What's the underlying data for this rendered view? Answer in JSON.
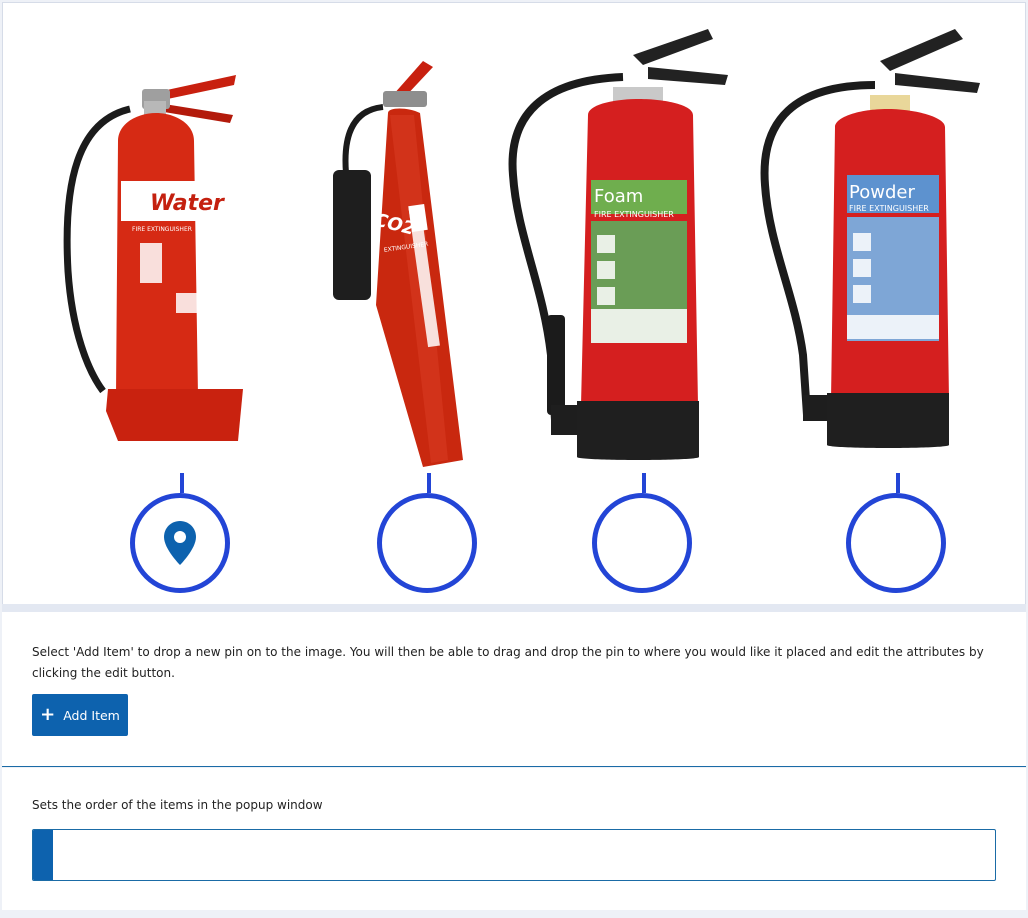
{
  "extinguishers": [
    {
      "label": "Water",
      "subtitle": "FIRE EXTINGUISHER",
      "body_color": "#d62a14",
      "label_color": "#ffffff",
      "text_color": "#c4200f",
      "has_pin": true
    },
    {
      "label": "CO2",
      "subtitle": "EXTINGUISHER",
      "body_color": "#c9280f",
      "label_color": "#ffffff",
      "text_color": "#c4200f",
      "has_pin": false
    },
    {
      "label": "Foam",
      "subtitle": "FIRE EXTINGUISHER",
      "body_color": "#d51f1f",
      "label_color": "#6fae4e",
      "text_color": "#ffffff",
      "has_pin": false
    },
    {
      "label": "Powder",
      "subtitle": "FIRE EXTINGUISHER",
      "body_color": "#d51f1f",
      "label_color": "#5d92cf",
      "text_color": "#ffffff",
      "has_pin": false
    }
  ],
  "hotspot_icon": "map-pin-icon",
  "colors": {
    "hotspot": "#2345d6",
    "button": "#0d62ae",
    "field_border": "#1a6ba6"
  },
  "instructions": "Select 'Add Item' to drop a new pin on to the image. You will then be able to drag and drop the pin to where you would like it placed and edit the attributes by clicking the edit button.",
  "add_button": {
    "label": "Add Item",
    "icon": "plus-icon"
  },
  "order": {
    "label": "Sets the order of the items in the popup window",
    "value": ""
  }
}
